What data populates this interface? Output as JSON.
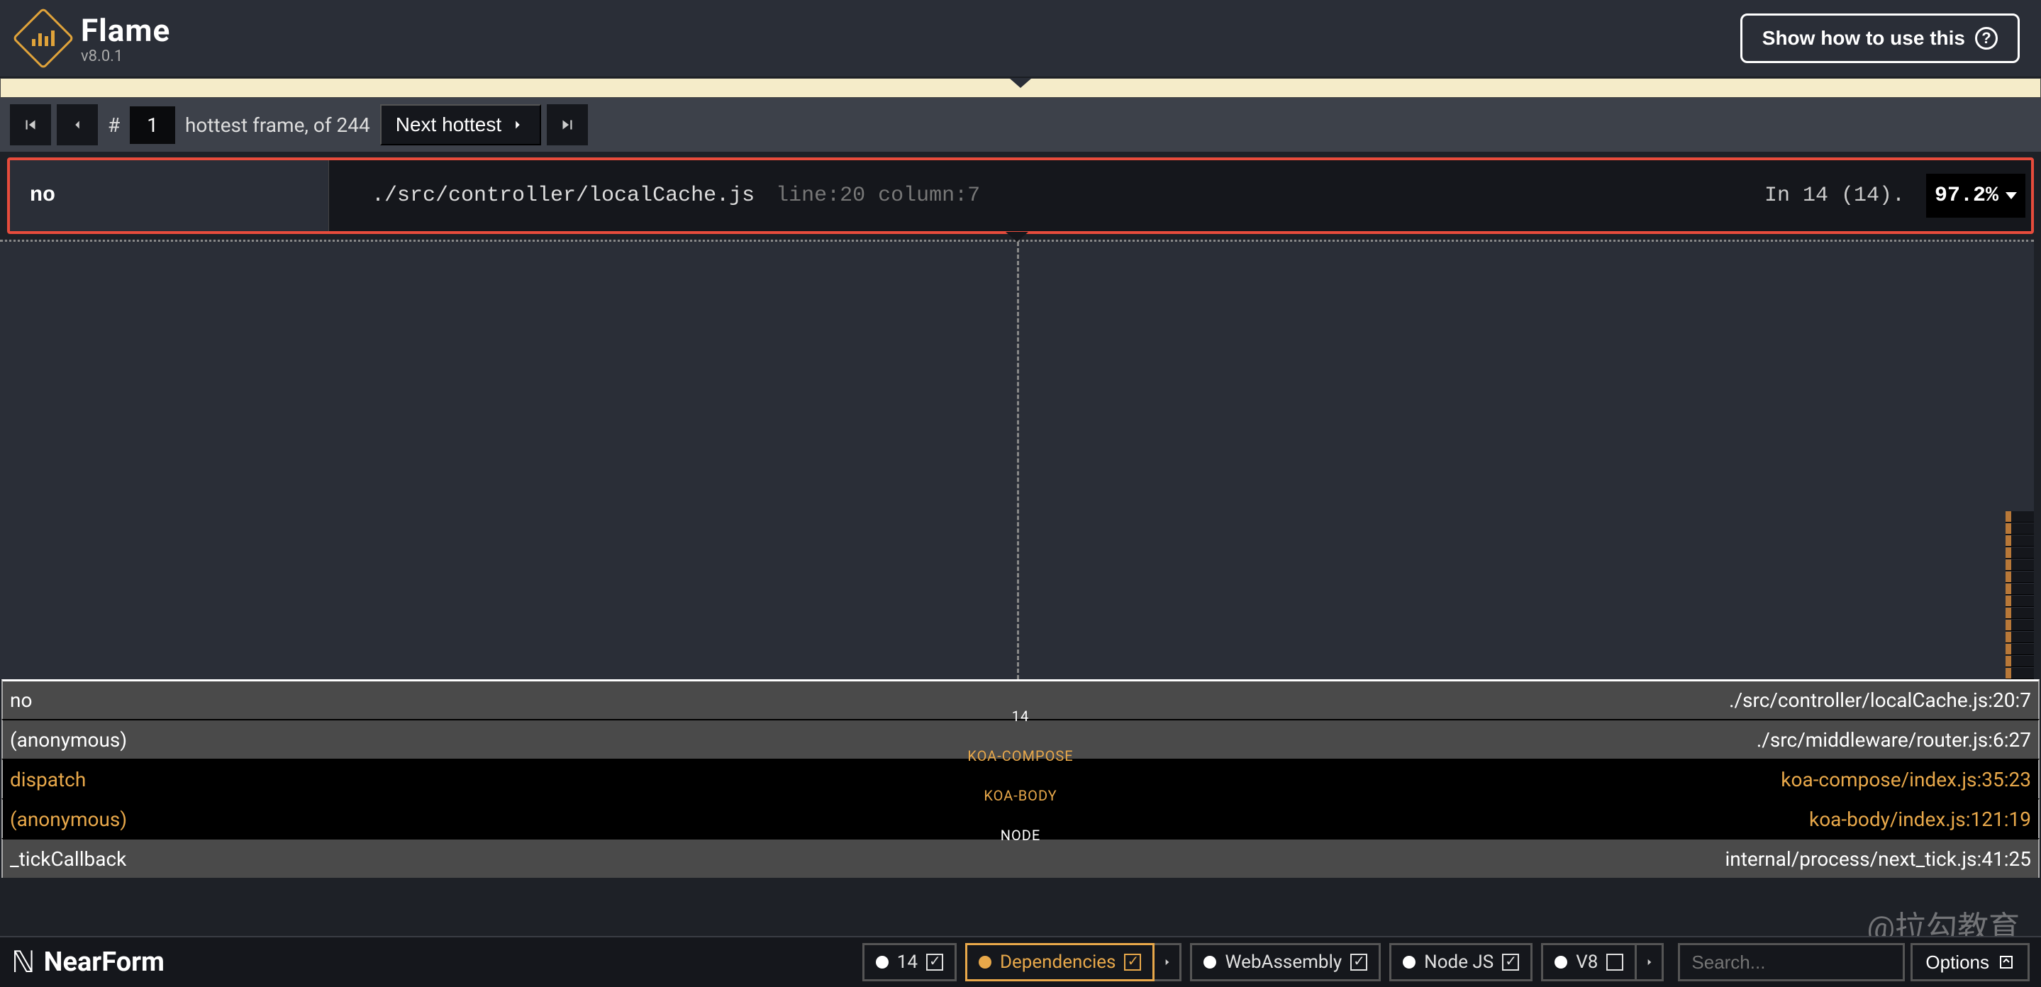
{
  "header": {
    "app_name": "Flame",
    "version": "v8.0.1",
    "help_label": "Show how to use this"
  },
  "nav": {
    "hash": "#",
    "frame_number": "1",
    "frame_label_suffix": "hottest frame, of 244",
    "next_label": "Next hottest"
  },
  "frame_banner": {
    "fn_name": "no",
    "file_path": "./src/controller/localCache.js",
    "location": "line:20 column:7",
    "stats": "In 14  (14).",
    "percent": "97.2%"
  },
  "stack": [
    {
      "style": "light",
      "name": "no",
      "path": "./src/controller/localCache.js:20:7",
      "divider": "",
      "selected": true
    },
    {
      "style": "light",
      "name": "(anonymous)",
      "path": "./src/middleware/router.js:6:27",
      "divider": "14",
      "divider_color": "white"
    },
    {
      "style": "dark",
      "name": "dispatch",
      "path": "koa-compose/index.js:35:23",
      "divider": "KOA-COMPOSE",
      "divider_color": "orange"
    },
    {
      "style": "dark",
      "name": "(anonymous)",
      "path": "koa-body/index.js:121:19",
      "divider": "KOA-BODY",
      "divider_color": "orange"
    },
    {
      "style": "light",
      "name": "_tickCallback",
      "path": "internal/process/next_tick.js:41:25",
      "divider": "NODE",
      "divider_color": "white"
    }
  ],
  "footer": {
    "brand": "NearForm",
    "chips": [
      {
        "label": "14",
        "active": false,
        "checked": true,
        "more": false
      },
      {
        "label": "Dependencies",
        "active": true,
        "checked": true,
        "more": true
      },
      {
        "label": "WebAssembly",
        "active": false,
        "checked": true,
        "more": false
      },
      {
        "label": "Node JS",
        "active": false,
        "checked": true,
        "more": false
      },
      {
        "label": "V8",
        "active": false,
        "checked": false,
        "more": true
      }
    ],
    "search_placeholder": "Search...",
    "options_label": "Options"
  },
  "watermark": "@拉勾教育"
}
